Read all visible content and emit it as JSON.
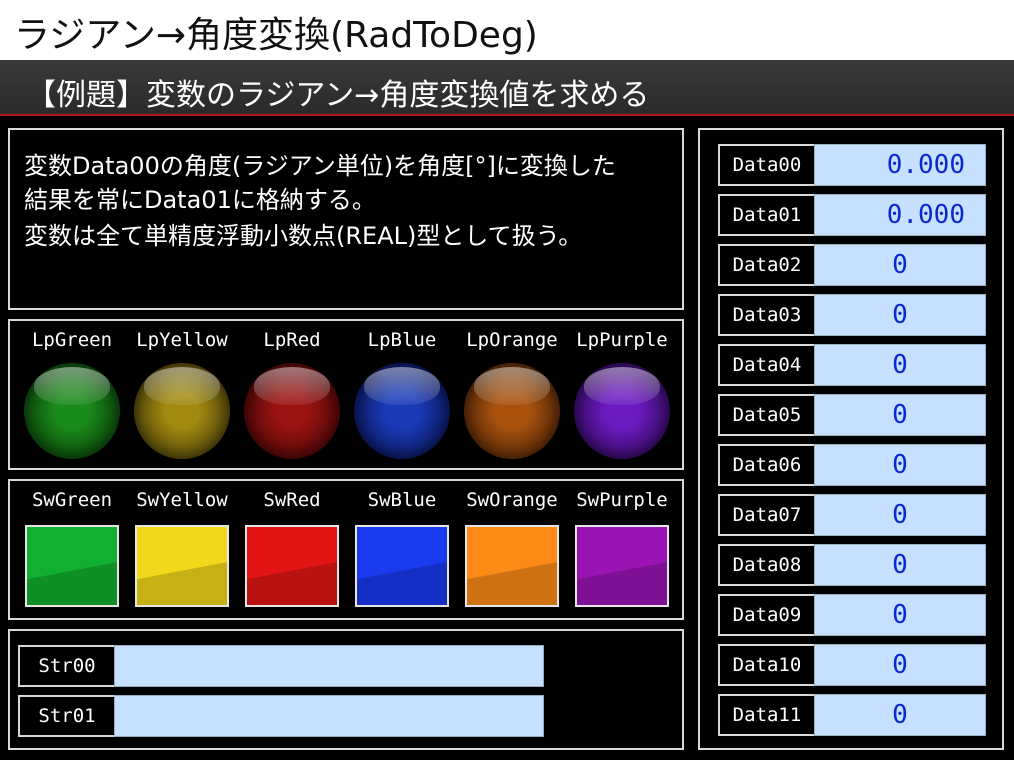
{
  "title": "ラジアン→角度変換(RadToDeg)",
  "subtitle": "【例題】変数のラジアン→角度変換値を求める",
  "description": [
    "変数Data00の角度(ラジアン単位)を角度[°]に変換した",
    "結果を常にData01に格納する。",
    "変数は全て単精度浮動小数点(REAL)型として扱う。"
  ],
  "lamps": [
    {
      "label": "LpGreen",
      "color": "#1a8a1a",
      "dark": "#062806"
    },
    {
      "label": "LpYellow",
      "color": "#a08a10",
      "dark": "#2e2606"
    },
    {
      "label": "LpRed",
      "color": "#9a1212",
      "dark": "#2c0404"
    },
    {
      "label": "LpBlue",
      "color": "#1a3ab8",
      "dark": "#060c36"
    },
    {
      "label": "LpOrange",
      "color": "#a8520e",
      "dark": "#321604"
    },
    {
      "label": "LpPurple",
      "color": "#6a1ac0",
      "dark": "#1e0638"
    }
  ],
  "switches": [
    {
      "label": "SwGreen",
      "color": "#12b030"
    },
    {
      "label": "SwYellow",
      "color": "#f2d81a"
    },
    {
      "label": "SwRed",
      "color": "#e21414"
    },
    {
      "label": "SwBlue",
      "color": "#1a3af0"
    },
    {
      "label": "SwOrange",
      "color": "#fb8a16"
    },
    {
      "label": "SwPurple",
      "color": "#9a14b4"
    }
  ],
  "strings": [
    {
      "label": "Str00",
      "value": ""
    },
    {
      "label": "Str01",
      "value": ""
    }
  ],
  "data": [
    {
      "label": "Data00",
      "value": "0.000"
    },
    {
      "label": "Data01",
      "value": "0.000"
    },
    {
      "label": "Data02",
      "value": "0"
    },
    {
      "label": "Data03",
      "value": "0"
    },
    {
      "label": "Data04",
      "value": "0"
    },
    {
      "label": "Data05",
      "value": "0"
    },
    {
      "label": "Data06",
      "value": "0"
    },
    {
      "label": "Data07",
      "value": "0"
    },
    {
      "label": "Data08",
      "value": "0"
    },
    {
      "label": "Data09",
      "value": "0"
    },
    {
      "label": "Data10",
      "value": "0"
    },
    {
      "label": "Data11",
      "value": "0"
    }
  ]
}
